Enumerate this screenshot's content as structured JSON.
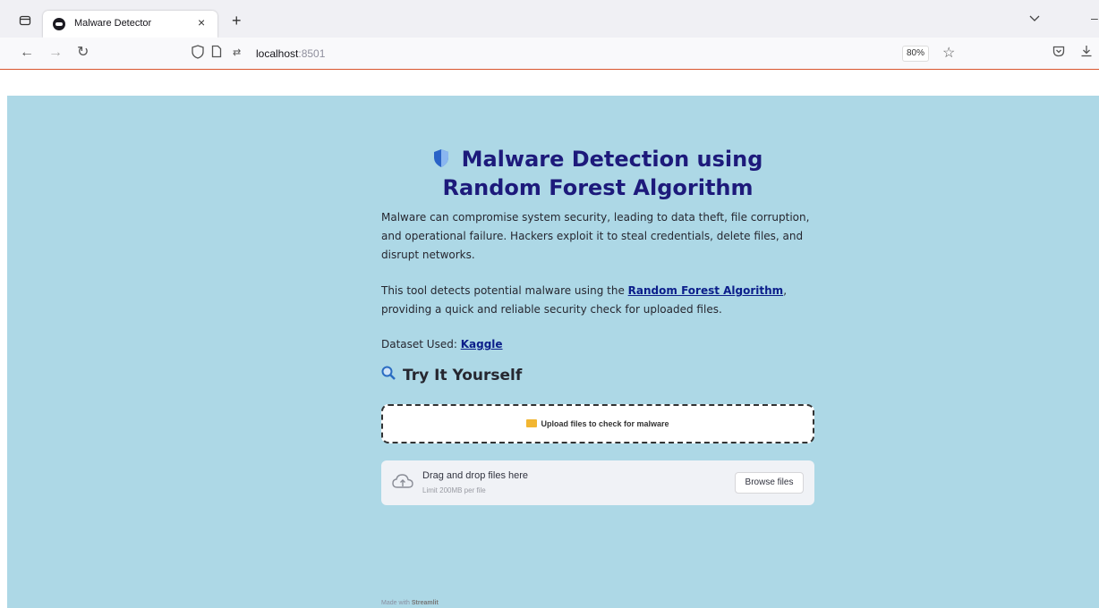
{
  "browser": {
    "tab_title": "Malware Detector",
    "tab_close": "×",
    "new_tab": "+",
    "url_host": "localhost",
    "url_port": ":8501",
    "zoom": "80%"
  },
  "page": {
    "title": "Malware Detection using Random Forest Algorithm",
    "intro": "Malware can compromise system security, leading to data theft, file corruption, and operational failure. Hackers exploit it to steal credentials, delete files, and disrupt networks.",
    "tool_prefix": "This tool detects potential malware using the ",
    "tool_link": "Random Forest Algorithm",
    "tool_suffix": ", providing a quick and reliable security check for uploaded files.",
    "dataset_prefix": "Dataset Used: ",
    "dataset_link": "Kaggle",
    "section_title": "Try It Yourself",
    "upload_label": "Upload files to check for malware",
    "dropzone_title": "Drag and drop files here",
    "dropzone_limit": "Limit 200MB per file",
    "browse_label": "Browse files",
    "footer_prefix": "Made with ",
    "footer_brand": "Streamlit"
  }
}
